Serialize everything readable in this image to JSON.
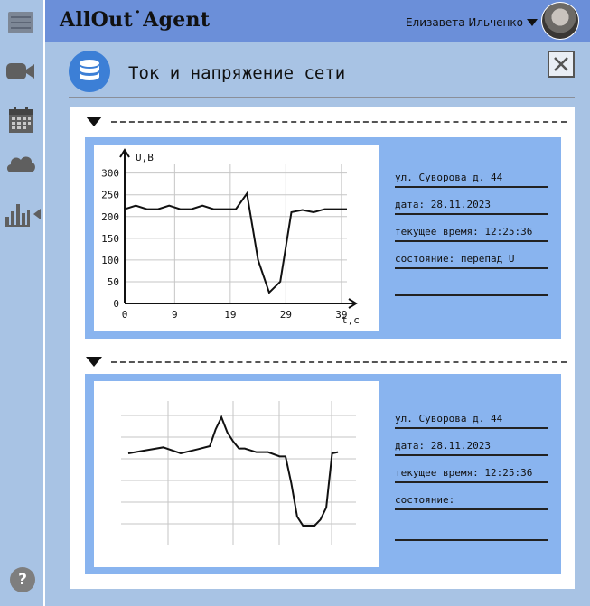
{
  "app": {
    "title": "AllOut˙Agent"
  },
  "user": {
    "name": "Елизавета Ильченко"
  },
  "page": {
    "title": "Ток и напряжение сети"
  },
  "sidebar": {
    "items": [
      "menu-icon",
      "video-camera-icon",
      "calendar-icon",
      "cloud-icon",
      "bar-chart-icon"
    ],
    "help_label": "?"
  },
  "sections": [
    {
      "address": "ул. Суворова д. 44",
      "date": "дата: 28.11.2023",
      "time": "текущее время: 12:25:36",
      "state": "состояние: перепад U",
      "extra": ""
    },
    {
      "address": "ул. Суворова д. 44",
      "date": "дата: 28.11.2023",
      "time": "текущее время: 12:25:36",
      "state": "состояние:",
      "extra": ""
    }
  ],
  "chart_data": [
    {
      "type": "line",
      "xlabel": "t,c",
      "ylabel": "U,B",
      "xticks": [
        "0",
        "9",
        "19",
        "29",
        "39"
      ],
      "yticks": [
        "0",
        "50",
        "100",
        "150",
        "200",
        "250",
        "300"
      ],
      "xlim": [
        0,
        40
      ],
      "ylim": [
        0,
        320
      ],
      "grid": true,
      "series": [
        {
          "x": [
            0,
            2,
            4,
            6,
            8,
            10,
            12,
            14,
            16,
            18,
            20,
            22,
            24,
            26,
            28,
            30,
            32,
            34,
            36,
            38,
            40
          ],
          "y": [
            217,
            225,
            217,
            217,
            225,
            217,
            217,
            225,
            217,
            217,
            217,
            253,
            100,
            25,
            50,
            210,
            215,
            210,
            217,
            217,
            217
          ]
        }
      ]
    },
    {
      "type": "line",
      "xlabel": "",
      "ylabel": "",
      "xticks": [],
      "yticks": [],
      "grid": true,
      "series": [
        {
          "x": [
            0,
            3,
            6,
            9,
            12,
            14,
            15,
            16,
            17,
            18,
            19,
            20,
            22,
            24,
            26,
            27,
            28,
            29,
            30,
            31,
            32,
            33,
            34,
            35,
            36
          ],
          "y": [
            150,
            155,
            160,
            150,
            157,
            162,
            190,
            210,
            185,
            170,
            158,
            158,
            152,
            152,
            145,
            145,
            100,
            45,
            30,
            30,
            30,
            40,
            60,
            150,
            152
          ]
        }
      ]
    }
  ]
}
